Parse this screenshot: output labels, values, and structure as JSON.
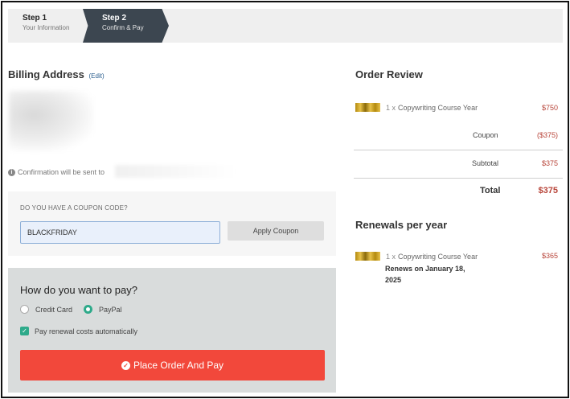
{
  "steps": [
    {
      "title": "Step 1",
      "subtitle": "Your Information"
    },
    {
      "title": "Step 2",
      "subtitle": "Confirm & Pay"
    }
  ],
  "billing": {
    "title": "Billing Address",
    "edit_label": "(Edit)",
    "confirmation_text": "Confirmation will be sent to"
  },
  "coupon": {
    "question": "DO YOU HAVE A COUPON CODE?",
    "input_value": "BLACKFRIDAY",
    "apply_label": "Apply Coupon"
  },
  "payment": {
    "title": "How do you want to pay?",
    "options": [
      "Credit Card",
      "PayPal"
    ],
    "selected": "PayPal",
    "auto_renew_label": "Pay renewal costs automatically",
    "auto_renew_checked": true,
    "place_order_label": "Place Order And Pay"
  },
  "order_review": {
    "title": "Order Review",
    "item_qty": "1 x",
    "item_name": "Copywriting Course Year",
    "item_price": "$750",
    "coupon_label": "Coupon",
    "coupon_value": "($375)",
    "subtotal_label": "Subtotal",
    "subtotal_value": "$375",
    "total_label": "Total",
    "total_value": "$375"
  },
  "renewals": {
    "title": "Renewals per year",
    "item_qty": "1 x",
    "item_name": "Copywriting Course Year",
    "renews_text": "Renews on January 18, 2025",
    "price": "$365"
  },
  "colors": {
    "accent_green": "#2eaa8a",
    "cta_red": "#f2483b",
    "price_red": "#b8453a",
    "step_active": "#3c4650"
  }
}
